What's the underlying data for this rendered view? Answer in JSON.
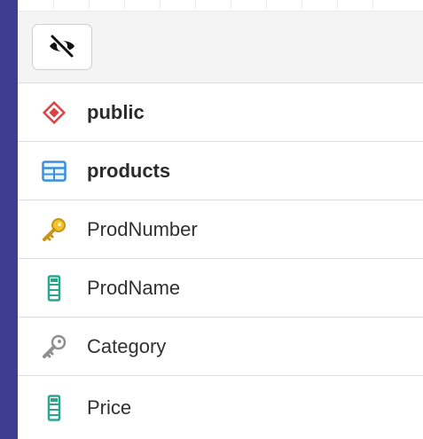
{
  "toolbar": {
    "visibility_toggle_icon": "eye-slash-icon"
  },
  "tree": {
    "items": [
      {
        "label": "public",
        "icon": "schema-diamond-icon",
        "bold": true
      },
      {
        "label": "products",
        "icon": "table-grid-icon",
        "bold": true
      },
      {
        "label": "ProdNumber",
        "icon": "primary-key-icon",
        "bold": false
      },
      {
        "label": "ProdName",
        "icon": "column-icon",
        "bold": false
      },
      {
        "label": "Category",
        "icon": "foreign-key-icon",
        "bold": false
      },
      {
        "label": "Price",
        "icon": "column-icon",
        "bold": false
      }
    ]
  },
  "colors": {
    "background": "#3d3d94",
    "schema_icon": "#d94545",
    "table_icon": "#3a8fd8",
    "key_icon": "#e0b020",
    "column_icon": "#2aa68f",
    "foreign_key_icon": "#9a9a9a"
  }
}
